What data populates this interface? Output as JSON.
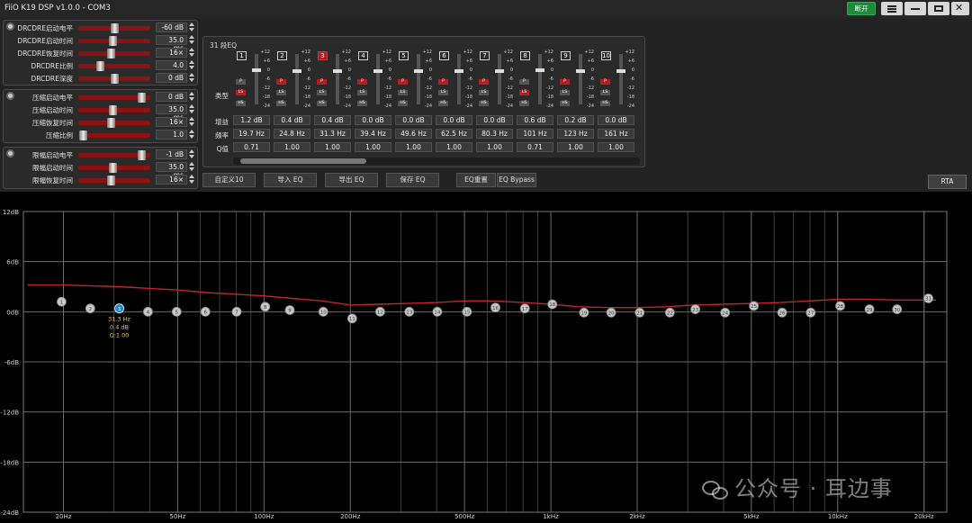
{
  "window": {
    "title": "FiiO K19 DSP v1.0.0 - COM3",
    "connect_label": "断开"
  },
  "drc": {
    "rows": [
      {
        "label": "DRCDRE启动电平",
        "value": "-60 dB",
        "pos": 0.5
      },
      {
        "label": "DRCDRE启动时间",
        "value": "35.0 ms",
        "pos": 0.47
      },
      {
        "label": "DRCDRE恢复时间",
        "value": "16×",
        "pos": 0.45
      },
      {
        "label": "DRCDRE比例",
        "value": "4.0",
        "pos": 0.28
      },
      {
        "label": "DRCDRE深度",
        "value": "0 dB",
        "pos": 0.5
      }
    ]
  },
  "comp": {
    "rows": [
      {
        "label": "压缩启动电平",
        "value": "0 dB",
        "pos": 0.92
      },
      {
        "label": "压缩启动时间",
        "value": "35.0 ms",
        "pos": 0.47
      },
      {
        "label": "压缩恢复时间",
        "value": "16×",
        "pos": 0.45
      },
      {
        "label": "压缩比例",
        "value": "1.0",
        "pos": 0.02
      }
    ]
  },
  "limit": {
    "rows": [
      {
        "label": "限幅启动电平",
        "value": "-1 dB",
        "pos": 0.92
      },
      {
        "label": "限幅启动时间",
        "value": "35.0 ms",
        "pos": 0.47
      },
      {
        "label": "限幅恢复时间",
        "value": "16×",
        "pos": 0.45
      }
    ]
  },
  "eq": {
    "title": "31 段EQ",
    "scale": [
      "+12",
      "+6",
      "0",
      "-6",
      "-12",
      "-18",
      "-24"
    ],
    "type_buttons": [
      "P",
      "LS",
      "HS"
    ],
    "row_labels": {
      "gain": "增益",
      "freq": "频率",
      "q": "Q值",
      "type": "类型"
    },
    "bands": [
      {
        "num": "1",
        "gain": "1.2 dB",
        "freq": "19.7 Hz",
        "q": "0.71",
        "type": "LS",
        "selected": false
      },
      {
        "num": "2",
        "gain": "0.4 dB",
        "freq": "24.8 Hz",
        "q": "1.00",
        "type": "P",
        "selected": false
      },
      {
        "num": "3",
        "gain": "0.4 dB",
        "freq": "31.3 Hz",
        "q": "1.00",
        "type": "P",
        "selected": true
      },
      {
        "num": "4",
        "gain": "0.0 dB",
        "freq": "39.4 Hz",
        "q": "1.00",
        "type": "P",
        "selected": false
      },
      {
        "num": "5",
        "gain": "0.0 dB",
        "freq": "49.6 Hz",
        "q": "1.00",
        "type": "P",
        "selected": false
      },
      {
        "num": "6",
        "gain": "0.0 dB",
        "freq": "62.5 Hz",
        "q": "1.00",
        "type": "P",
        "selected": false
      },
      {
        "num": "7",
        "gain": "0.0 dB",
        "freq": "80.3 Hz",
        "q": "1.00",
        "type": "P",
        "selected": false
      },
      {
        "num": "8",
        "gain": "0.6 dB",
        "freq": "101 Hz",
        "q": "0.71",
        "type": "LS",
        "selected": false
      },
      {
        "num": "9",
        "gain": "0.2 dB",
        "freq": "123 Hz",
        "q": "1.00",
        "type": "P",
        "selected": false
      },
      {
        "num": "10",
        "gain": "0.0 dB",
        "freq": "161 Hz",
        "q": "1.00",
        "type": "P",
        "selected": false
      }
    ]
  },
  "actions": {
    "custom": "自定义10",
    "import": "导入 EQ",
    "export": "导出 EQ",
    "save": "保存 EQ",
    "reset": "EQ重置",
    "bypass": "EQ Bypass",
    "rta": "RTA"
  },
  "graph": {
    "y_labels": [
      "12dB",
      "6dB",
      "0dB",
      "-6dB",
      "-12dB",
      "-18dB",
      "-24dB"
    ],
    "ylim": [
      -24,
      12
    ],
    "x_labels": [
      {
        "f": 20,
        "t": "20Hz"
      },
      {
        "f": 50,
        "t": "50Hz"
      },
      {
        "f": 100,
        "t": "100Hz"
      },
      {
        "f": 200,
        "t": "200Hz"
      },
      {
        "f": 500,
        "t": "500Hz"
      },
      {
        "f": 1000,
        "t": "1kHz"
      },
      {
        "f": 2000,
        "t": "2kHz"
      },
      {
        "f": 5000,
        "t": "5kHz"
      },
      {
        "f": 10000,
        "t": "10kHz"
      },
      {
        "f": 20000,
        "t": "20kHz"
      }
    ],
    "points": [
      {
        "n": "1",
        "f": 19.7,
        "g": 1.2
      },
      {
        "n": "2",
        "f": 24.8,
        "g": 0.4
      },
      {
        "n": "3",
        "f": 31.3,
        "g": 0.4
      },
      {
        "n": "4",
        "f": 39.4,
        "g": 0
      },
      {
        "n": "5",
        "f": 49.6,
        "g": 0
      },
      {
        "n": "6",
        "f": 62.5,
        "g": 0
      },
      {
        "n": "7",
        "f": 80.3,
        "g": 0
      },
      {
        "n": "8",
        "f": 101,
        "g": 0.6
      },
      {
        "n": "9",
        "f": 123,
        "g": 0.2
      },
      {
        "n": "10",
        "f": 161,
        "g": 0
      },
      {
        "n": "11",
        "f": 203,
        "g": -0.8
      },
      {
        "n": "12",
        "f": 254,
        "g": 0
      },
      {
        "n": "13",
        "f": 321,
        "g": 0
      },
      {
        "n": "14",
        "f": 402,
        "g": 0
      },
      {
        "n": "15",
        "f": 510,
        "g": 0
      },
      {
        "n": "16",
        "f": 641,
        "g": 0.5
      },
      {
        "n": "17",
        "f": 812,
        "g": 0.4
      },
      {
        "n": "18",
        "f": 1012,
        "g": 0.9
      },
      {
        "n": "19",
        "f": 1305,
        "g": -0.1
      },
      {
        "n": "20",
        "f": 1623,
        "g": -0.1
      },
      {
        "n": "21",
        "f": 2040,
        "g": -0.1
      },
      {
        "n": "22",
        "f": 2600,
        "g": -0.1
      },
      {
        "n": "23",
        "f": 3190,
        "g": 0.3
      },
      {
        "n": "24",
        "f": 4050,
        "g": -0.1
      },
      {
        "n": "25",
        "f": 5100,
        "g": 0.7
      },
      {
        "n": "26",
        "f": 6400,
        "g": -0.1
      },
      {
        "n": "27",
        "f": 8050,
        "g": -0.1
      },
      {
        "n": "28",
        "f": 10200,
        "g": 0.7
      },
      {
        "n": "29",
        "f": 12900,
        "g": 0.3
      },
      {
        "n": "30",
        "f": 16100,
        "g": 0.3
      },
      {
        "n": "31",
        "f": 20700,
        "g": 1.6
      }
    ],
    "curve": [
      [
        15,
        3.2
      ],
      [
        20,
        3.2
      ],
      [
        25,
        3.1
      ],
      [
        31.3,
        3.0
      ],
      [
        40,
        2.8
      ],
      [
        50,
        2.6
      ],
      [
        63,
        2.3
      ],
      [
        80,
        2.1
      ],
      [
        100,
        1.9
      ],
      [
        125,
        1.6
      ],
      [
        160,
        1.3
      ],
      [
        200,
        0.8
      ],
      [
        250,
        0.9
      ],
      [
        315,
        1.0
      ],
      [
        400,
        1.1
      ],
      [
        500,
        1.3
      ],
      [
        630,
        1.3
      ],
      [
        800,
        1.1
      ],
      [
        1000,
        0.9
      ],
      [
        1250,
        0.6
      ],
      [
        1600,
        0.5
      ],
      [
        2000,
        0.5
      ],
      [
        2500,
        0.6
      ],
      [
        3150,
        0.8
      ],
      [
        4000,
        0.9
      ],
      [
        5000,
        1.0
      ],
      [
        6300,
        1.1
      ],
      [
        8000,
        1.3
      ],
      [
        10000,
        1.5
      ],
      [
        12500,
        1.5
      ],
      [
        16000,
        1.4
      ],
      [
        22000,
        1.4
      ]
    ],
    "selected_tooltip": {
      "freq": "31.3 Hz",
      "gain": "0.4 dB",
      "q": "Q:1.00"
    },
    "curve_color": "#c0242c",
    "selected_color": "#1e88c8"
  },
  "watermark": {
    "text": "公众号 · 耳边事"
  }
}
